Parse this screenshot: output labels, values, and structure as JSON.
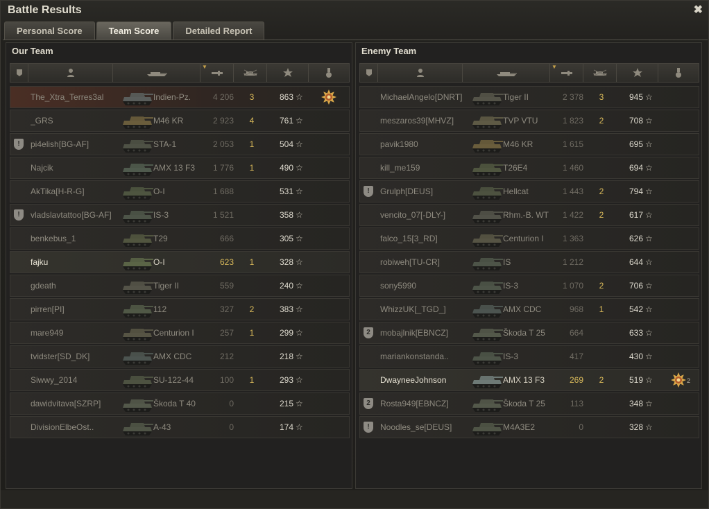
{
  "window": {
    "title": "Battle Results",
    "close_glyph": "✖"
  },
  "tabs": [
    "Personal Score",
    "Team Score",
    "Detailed Report"
  ],
  "active_tab": 1,
  "columns": {
    "icons": [
      "badge-column-icon",
      "player-column-icon",
      "vehicle-column-icon",
      "damage-column-icon",
      "kills-column-icon",
      "xp-column-icon",
      "medal-column-icon"
    ],
    "sorted_column": "damage"
  },
  "colors": {
    "highlight": "#4a2e24",
    "accent_gold": "#d9b95a",
    "text": "#8e8a7f"
  },
  "our_team": {
    "title": "Our Team",
    "rows": [
      {
        "badge": "",
        "player": "The_Xtra_Terres3al",
        "vehicle": "Indien-Pz.",
        "damage": "4 206",
        "kills": "3",
        "xp": "863",
        "medal": "ace-tanker-medal",
        "medal_count": "",
        "highlight": true,
        "self": false,
        "tank_color": "#5a5e5c"
      },
      {
        "badge": "",
        "player": "_GRS",
        "vehicle": "M46 KR",
        "damage": "2 923",
        "kills": "4",
        "xp": "761",
        "medal": "",
        "medal_count": "",
        "highlight": false,
        "self": false,
        "tank_color": "#6a5d3c"
      },
      {
        "badge": "!",
        "player": "pi4elish[BG-AF]",
        "vehicle": "STA-1",
        "damage": "2 053",
        "kills": "1",
        "xp": "504",
        "medal": "",
        "medal_count": "",
        "highlight": false,
        "self": false,
        "tank_color": "#4e5145"
      },
      {
        "badge": "",
        "player": "Najcik",
        "vehicle": "AMX 13 F3",
        "damage": "1 776",
        "kills": "1",
        "xp": "490",
        "medal": "",
        "medal_count": "",
        "highlight": false,
        "self": false,
        "tank_color": "#4f5a4d"
      },
      {
        "badge": "",
        "player": "AkTika[H-R-G]",
        "vehicle": "O-I",
        "damage": "1 688",
        "kills": "",
        "xp": "531",
        "medal": "",
        "medal_count": "",
        "highlight": false,
        "self": false,
        "tank_color": "#4e5540"
      },
      {
        "badge": "!",
        "player": "vladslavtattoo[BG-AF]",
        "vehicle": "IS-3",
        "damage": "1 521",
        "kills": "",
        "xp": "358",
        "medal": "",
        "medal_count": "",
        "highlight": false,
        "self": false,
        "tank_color": "#4d5448"
      },
      {
        "badge": "",
        "player": "benkebus_1",
        "vehicle": "T29",
        "damage": "666",
        "kills": "",
        "xp": "305",
        "medal": "",
        "medal_count": "",
        "highlight": false,
        "self": false,
        "tank_color": "#51553f"
      },
      {
        "badge": "",
        "player": "fajku",
        "vehicle": "O-I",
        "damage": "623",
        "kills": "1",
        "xp": "328",
        "medal": "",
        "medal_count": "",
        "highlight": false,
        "self": true,
        "tank_color": "#5a6446"
      },
      {
        "badge": "",
        "player": "gdeath",
        "vehicle": "Tiger II",
        "damage": "559",
        "kills": "",
        "xp": "240",
        "medal": "",
        "medal_count": "",
        "highlight": false,
        "self": false,
        "tank_color": "#545348"
      },
      {
        "badge": "",
        "player": "pirren[PI]",
        "vehicle": "112",
        "damage": "327",
        "kills": "2",
        "xp": "383",
        "medal": "",
        "medal_count": "",
        "highlight": false,
        "self": false,
        "tank_color": "#505846"
      },
      {
        "badge": "",
        "player": "mare949",
        "vehicle": "Centurion I",
        "damage": "257",
        "kills": "1",
        "xp": "299",
        "medal": "",
        "medal_count": "",
        "highlight": false,
        "self": false,
        "tank_color": "#565444"
      },
      {
        "badge": "",
        "player": "tvidster[SD_DK]",
        "vehicle": "AMX CDC",
        "damage": "212",
        "kills": "",
        "xp": "218",
        "medal": "",
        "medal_count": "",
        "highlight": false,
        "self": false,
        "tank_color": "#4c5450"
      },
      {
        "badge": "",
        "player": "Siwwy_2014",
        "vehicle": "SU-122-44",
        "damage": "100",
        "kills": "1",
        "xp": "293",
        "medal": "",
        "medal_count": "",
        "highlight": false,
        "self": false,
        "tank_color": "#4d5241"
      },
      {
        "badge": "",
        "player": "dawidvitava[SZRP]",
        "vehicle": "Škoda T 40",
        "damage": "0",
        "kills": "",
        "xp": "215",
        "medal": "",
        "medal_count": "",
        "highlight": false,
        "self": false,
        "tank_color": "#53584a"
      },
      {
        "badge": "",
        "player": "DivisionElbeOst..",
        "vehicle": "A-43",
        "damage": "0",
        "kills": "",
        "xp": "174",
        "medal": "",
        "medal_count": "",
        "highlight": false,
        "self": false,
        "tank_color": "#4f5446"
      }
    ]
  },
  "enemy_team": {
    "title": "Enemy Team",
    "rows": [
      {
        "badge": "",
        "player": "MichaelAngelo[DNRT]",
        "vehicle": "Tiger II",
        "damage": "2 378",
        "kills": "3",
        "xp": "945",
        "medal": "",
        "medal_count": "",
        "highlight": false,
        "self": false,
        "tank_color": "#545348"
      },
      {
        "badge": "",
        "player": "meszaros39[MHVZ]",
        "vehicle": "TVP VTU",
        "damage": "1 823",
        "kills": "2",
        "xp": "708",
        "medal": "",
        "medal_count": "",
        "highlight": false,
        "self": false,
        "tank_color": "#5e5a45"
      },
      {
        "badge": "",
        "player": "pavik1980",
        "vehicle": "M46 KR",
        "damage": "1 615",
        "kills": "",
        "xp": "695",
        "medal": "",
        "medal_count": "",
        "highlight": false,
        "self": false,
        "tank_color": "#6a5d3c"
      },
      {
        "badge": "",
        "player": "kill_me159",
        "vehicle": "T26E4",
        "damage": "1 460",
        "kills": "",
        "xp": "694",
        "medal": "",
        "medal_count": "",
        "highlight": false,
        "self": false,
        "tank_color": "#4f553f"
      },
      {
        "badge": "!",
        "player": "Grulph[DEUS]",
        "vehicle": "Hellcat",
        "damage": "1 443",
        "kills": "2",
        "xp": "794",
        "medal": "",
        "medal_count": "",
        "highlight": false,
        "self": false,
        "tank_color": "#4d5240"
      },
      {
        "badge": "",
        "player": "vencito_07[-DLY-]",
        "vehicle": "Rhm.-B. WT",
        "damage": "1 422",
        "kills": "2",
        "xp": "617",
        "medal": "",
        "medal_count": "",
        "highlight": false,
        "self": false,
        "tank_color": "#515148"
      },
      {
        "badge": "",
        "player": "falco_15[3_RD]",
        "vehicle": "Centurion I",
        "damage": "1 363",
        "kills": "",
        "xp": "626",
        "medal": "",
        "medal_count": "",
        "highlight": false,
        "self": false,
        "tank_color": "#565444"
      },
      {
        "badge": "",
        "player": "robiweh[TU-CR]",
        "vehicle": "IS",
        "damage": "1 212",
        "kills": "",
        "xp": "644",
        "medal": "",
        "medal_count": "",
        "highlight": false,
        "self": false,
        "tank_color": "#4d5448"
      },
      {
        "badge": "",
        "player": "sony5990",
        "vehicle": "IS-3",
        "damage": "1 070",
        "kills": "2",
        "xp": "706",
        "medal": "",
        "medal_count": "",
        "highlight": false,
        "self": false,
        "tank_color": "#4d5448"
      },
      {
        "badge": "",
        "player": "WhizzUK[_TGD_]",
        "vehicle": "AMX CDC",
        "damage": "968",
        "kills": "1",
        "xp": "542",
        "medal": "",
        "medal_count": "",
        "highlight": false,
        "self": false,
        "tank_color": "#4c5450"
      },
      {
        "badge": "2",
        "player": "mobajlnik[EBNCZ]",
        "vehicle": "Škoda T 25",
        "damage": "664",
        "kills": "",
        "xp": "633",
        "medal": "",
        "medal_count": "",
        "highlight": false,
        "self": false,
        "tank_color": "#53584a"
      },
      {
        "badge": "",
        "player": "mariankonstanda..",
        "vehicle": "IS-3",
        "damage": "417",
        "kills": "",
        "xp": "430",
        "medal": "",
        "medal_count": "",
        "highlight": false,
        "self": false,
        "tank_color": "#4d5448"
      },
      {
        "badge": "",
        "player": "DwayneeJohnson",
        "vehicle": "AMX 13 F3",
        "damage": "269",
        "kills": "2",
        "xp": "519",
        "medal": "ace-tanker-medal",
        "medal_count": "2",
        "highlight": false,
        "self": true,
        "tank_color": "#6e7a76"
      },
      {
        "badge": "2",
        "player": "Rosta949[EBNCZ]",
        "vehicle": "Škoda T 25",
        "damage": "113",
        "kills": "",
        "xp": "348",
        "medal": "",
        "medal_count": "",
        "highlight": false,
        "self": false,
        "tank_color": "#53584a"
      },
      {
        "badge": "!",
        "player": "Noodles_se[DEUS]",
        "vehicle": "M4A3E2",
        "damage": "0",
        "kills": "",
        "xp": "328",
        "medal": "",
        "medal_count": "",
        "highlight": false,
        "self": false,
        "tank_color": "#4f5446"
      }
    ]
  }
}
